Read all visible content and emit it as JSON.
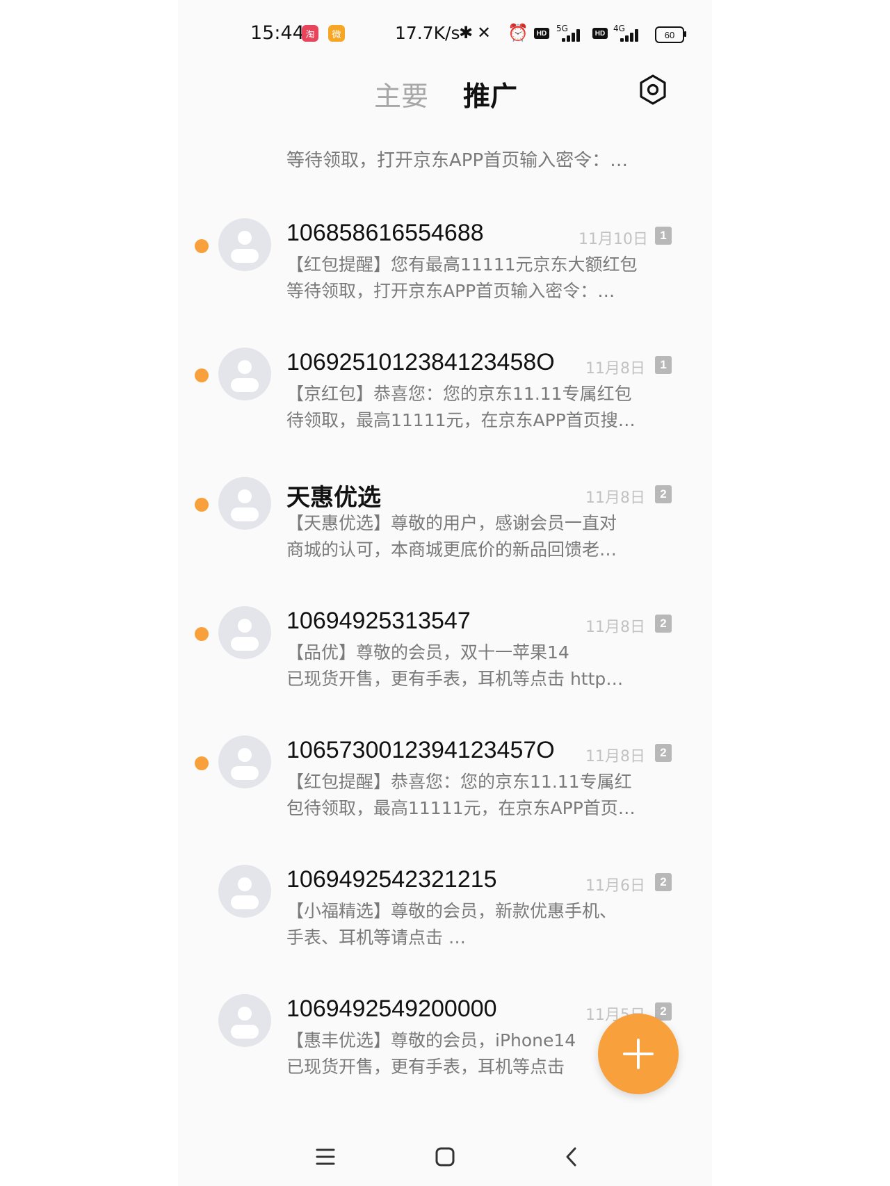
{
  "status_bar": {
    "time": "15:44",
    "app_badge_1": "淘",
    "app_badge_2": "微",
    "net_speed": "17.7K/s",
    "bluetooth": "✱",
    "mute": "✕",
    "alarm": "⏰",
    "hd_label": "HD",
    "net_1": "5G",
    "net_2": "4G",
    "battery": "60"
  },
  "header": {
    "tab_main": "主要",
    "tab_promo": "推广",
    "accent_color": "#f8a13c"
  },
  "partial_top": "等待领取，打开京东APP首页输入密令：…",
  "messages": [
    {
      "sender": "106858616554688",
      "date": "11月10日",
      "sim": "1",
      "unread": true,
      "line1": "【红包提醒】您有最高11111元京东大额红包",
      "line2": "等待领取，打开京东APP首页输入密令：…"
    },
    {
      "sender": "1069251012384123458O",
      "date": "11月8日",
      "sim": "1",
      "unread": true,
      "line1": "【京红包】恭喜您：您的京东11.11专属红包",
      "line2": "待领取，最高11111元，在京东APP首页搜…"
    },
    {
      "sender": "天惠优选",
      "date": "11月8日",
      "sim": "2",
      "unread": true,
      "line1": "【天惠优选】尊敬的用户，感谢会员一直对",
      "line2": "商城的认可，本商城更底价的新品回馈老…"
    },
    {
      "sender": "10694925313547",
      "date": "11月8日",
      "sim": "2",
      "unread": true,
      "line1": "【品优】尊敬的会员，双十一苹果14",
      "line2": "已现货开售，更有手表，耳机等点击 http…"
    },
    {
      "sender": "1065730012394123457O",
      "date": "11月8日",
      "sim": "2",
      "unread": true,
      "line1": "【红包提醒】恭喜您：您的京东11.11专属红",
      "line2": "包待领取，最高11111元，在京东APP首页…"
    },
    {
      "sender": "1069492542321215",
      "date": "11月6日",
      "sim": "2",
      "unread": false,
      "line1": "【小福精选】尊敬的会员，新款优惠手机、",
      "line2": "手表、耳机等请点击 …"
    },
    {
      "sender": "1069492549200000",
      "date": "11月5日",
      "sim": "2",
      "unread": false,
      "line1": "【惠丰优选】尊敬的会员，iPhone14",
      "line2": "已现货开售，更有手表，耳机等点击"
    }
  ]
}
